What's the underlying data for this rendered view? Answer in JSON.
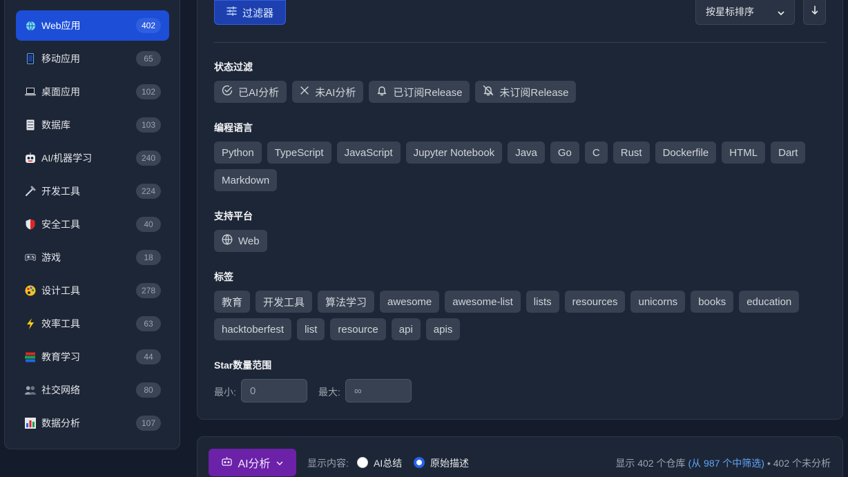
{
  "sidebar": {
    "items": [
      {
        "label": "Web应用",
        "count": "402",
        "icon": "globe-icon",
        "active": true
      },
      {
        "label": "移动应用",
        "count": "65",
        "icon": "mobile-phone-icon"
      },
      {
        "label": "桌面应用",
        "count": "102",
        "icon": "laptop-icon"
      },
      {
        "label": "数据库",
        "count": "103",
        "icon": "database-icon"
      },
      {
        "label": "AI/机器学习",
        "count": "240",
        "icon": "robot-icon"
      },
      {
        "label": "开发工具",
        "count": "224",
        "icon": "wrench-icon"
      },
      {
        "label": "安全工具",
        "count": "40",
        "icon": "shield-icon"
      },
      {
        "label": "游戏",
        "count": "18",
        "icon": "gamepad-icon"
      },
      {
        "label": "设计工具",
        "count": "278",
        "icon": "palette-icon"
      },
      {
        "label": "效率工具",
        "count": "63",
        "icon": "lightning-icon"
      },
      {
        "label": "教育学习",
        "count": "44",
        "icon": "books-icon"
      },
      {
        "label": "社交网络",
        "count": "80",
        "icon": "people-icon"
      },
      {
        "label": "数据分析",
        "count": "107",
        "icon": "bar-chart-icon"
      }
    ]
  },
  "toolbar": {
    "filter_label": "过滤器",
    "sort_value": "按星标排序"
  },
  "filters": {
    "status": {
      "title": "状态过滤",
      "chips": [
        {
          "label": "已AI分析",
          "icon": "check-circle-icon"
        },
        {
          "label": "未AI分析",
          "icon": "x-icon"
        },
        {
          "label": "已订阅Release",
          "icon": "bell-icon"
        },
        {
          "label": "未订阅Release",
          "icon": "bell-off-icon"
        }
      ]
    },
    "languages": {
      "title": "编程语言",
      "row1": [
        "Python",
        "TypeScript",
        "JavaScript",
        "Jupyter Notebook",
        "Java",
        "Go",
        "C",
        "Rust",
        "Dockerfile",
        "HTML",
        "Dart"
      ],
      "row2": [
        "Markdown"
      ]
    },
    "platforms": {
      "title": "支持平台",
      "chips": [
        {
          "label": "Web",
          "icon": "globe-icon"
        }
      ]
    },
    "tags": {
      "title": "标签",
      "row1": [
        "教育",
        "开发工具",
        "算法学习",
        "awesome",
        "awesome-list",
        "lists",
        "resources",
        "unicorns",
        "books",
        "education"
      ],
      "row2": [
        "hacktoberfest",
        "list",
        "resource",
        "api",
        "apis"
      ]
    },
    "stars": {
      "title": "Star数量范围",
      "min_label": "最小:",
      "min_placeholder": "0",
      "max_label": "最大:",
      "max_placeholder": "∞"
    }
  },
  "bottom": {
    "ai_button": "AI分析",
    "show_label": "显示内容:",
    "option_ai_summary": "AI总结",
    "option_original": "原始描述",
    "selected_option": "原始描述",
    "stats_shown": "显示 402 个仓库",
    "stats_filtered": "(从 987 个中筛选)",
    "stats_unanalyzed": "• 402 个未分析"
  },
  "colors": {
    "accent": "#1d4ed8",
    "ai_purple": "#6b21a8",
    "link": "#60a5fa"
  }
}
